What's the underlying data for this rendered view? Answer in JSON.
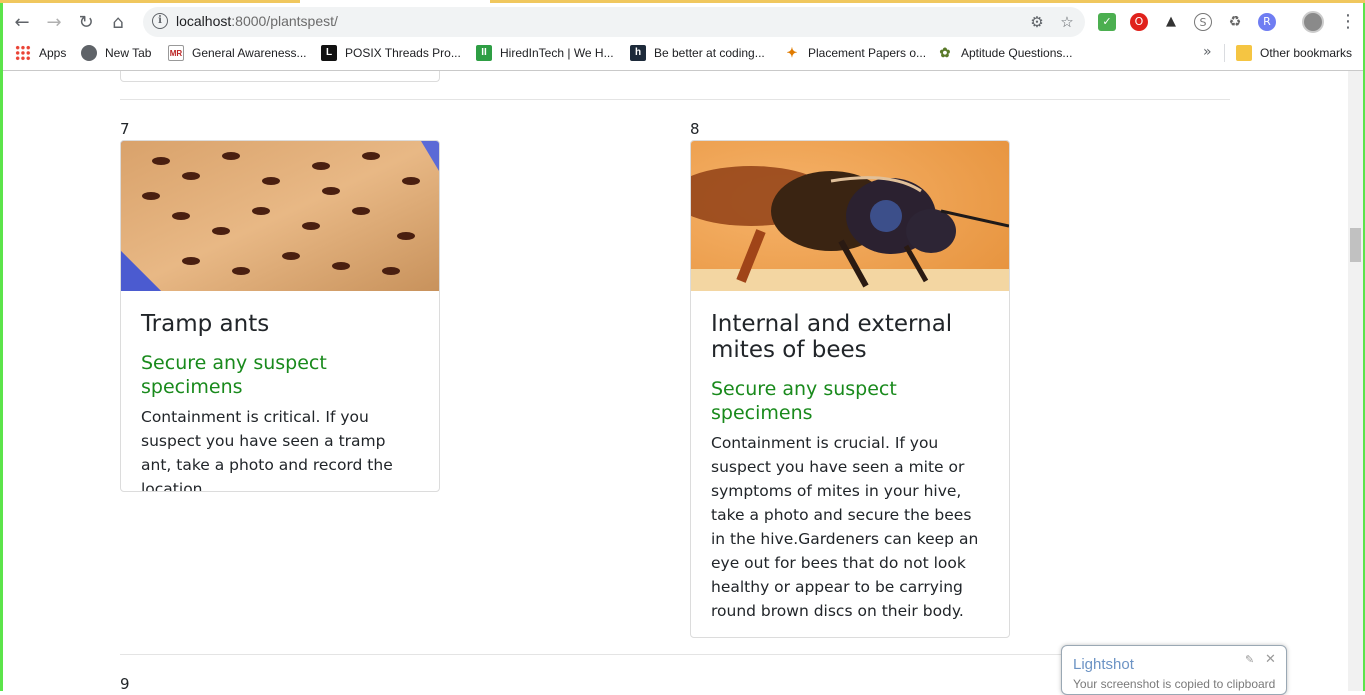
{
  "browser": {
    "url_host": "localhost",
    "url_rest": ":8000/plantspest/",
    "bookmarks": [
      {
        "label": "Apps",
        "icon": "apps-grid-icon"
      },
      {
        "label": "New Tab",
        "icon": "globe-icon"
      },
      {
        "label": "General Awareness...",
        "icon": "mr-icon"
      },
      {
        "label": "POSIX Threads Pro...",
        "icon": "posix-icon"
      },
      {
        "label": "HiredInTech | We H...",
        "icon": "hiredintech-icon"
      },
      {
        "label": "Be better at coding...",
        "icon": "hackerrank-icon"
      },
      {
        "label": "Placement Papers o...",
        "icon": "placement-icon"
      },
      {
        "label": "Aptitude Questions...",
        "icon": "aptitude-icon"
      }
    ],
    "overflow_label": "»",
    "other_bookmarks": "Other bookmarks"
  },
  "cards": [
    {
      "index": "7",
      "title": "Tramp ants",
      "subtitle": "Secure any suspect specimens",
      "text": "Containment is critical. If you suspect you have seen a tramp ant, take a photo and record the location.",
      "image": "ants-on-wood-photo"
    },
    {
      "index": "8",
      "title": "Internal and external mites of bees",
      "subtitle": "Secure any suspect specimens",
      "text": "Containment is crucial. If you suspect you have seen a mite or symptoms of mites in your hive, take a photo and secure the bees in the hive.Gardeners can keep an eye out for bees that do not look healthy or appear to be carrying round brown discs on their body.",
      "image": "bee-closeup-photo"
    }
  ],
  "next_index": "9",
  "lightshot": {
    "title": "Lightshot",
    "message": "Your screenshot is copied to clipboard"
  },
  "colors": {
    "subtitle_green": "#198a1c",
    "lightshot_blue": "#6c93c4"
  }
}
